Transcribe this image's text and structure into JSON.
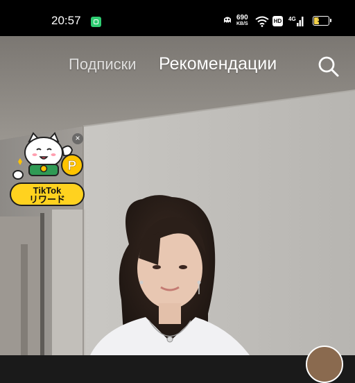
{
  "status_bar": {
    "time": "20:57",
    "net_speed_value": "690",
    "net_speed_unit": "KB/S",
    "hd_label": "HD",
    "signal_label": "4G",
    "battery_level": "37",
    "battery_fraction": 0.37,
    "icons": [
      "app-notification-icon",
      "alien-icon",
      "wifi-icon",
      "hd-icon",
      "cell-signal-icon",
      "battery-icon"
    ]
  },
  "top_nav": {
    "tabs": [
      {
        "label": "Подписки"
      },
      {
        "label": "Рекомендации"
      }
    ],
    "search_icon": "search-icon"
  },
  "reward_widget": {
    "line1": "TikTok",
    "line2": "リワード",
    "coin_letter": "P",
    "close_label": "×"
  },
  "colors": {
    "status_bar_bg": "#000000",
    "reward_yellow": "#ffd21f",
    "app_badge_green": "#2ecc71"
  }
}
